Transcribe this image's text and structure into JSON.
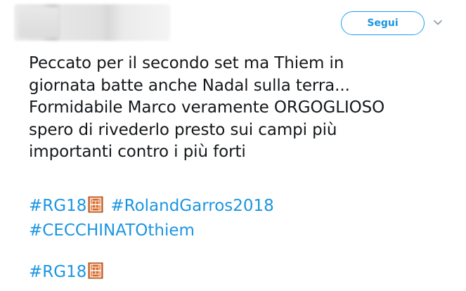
{
  "header": {
    "follow_label": "Segui",
    "chevron_icon": "chevron-down-icon",
    "accent_color": "#1da1f2"
  },
  "tweet": {
    "lines": [
      "Peccato per il secondo set ma Thiem in",
      "giornata batte anche Nadal sulla terra...",
      "Formidabile Marco veramente ORGOGLIOSO",
      "spero di rivederlo presto sui campi più",
      "importanti contro i più forti"
    ],
    "hashtag_block_1": {
      "tag1": "#RG18",
      "tag2": "#RolandGarros2018",
      "tag3": "#CECCHINATOthiem"
    },
    "hashtag_block_2": {
      "tag1": "#RG18"
    },
    "emoji_icon": "clay-tennis-court-icon"
  }
}
